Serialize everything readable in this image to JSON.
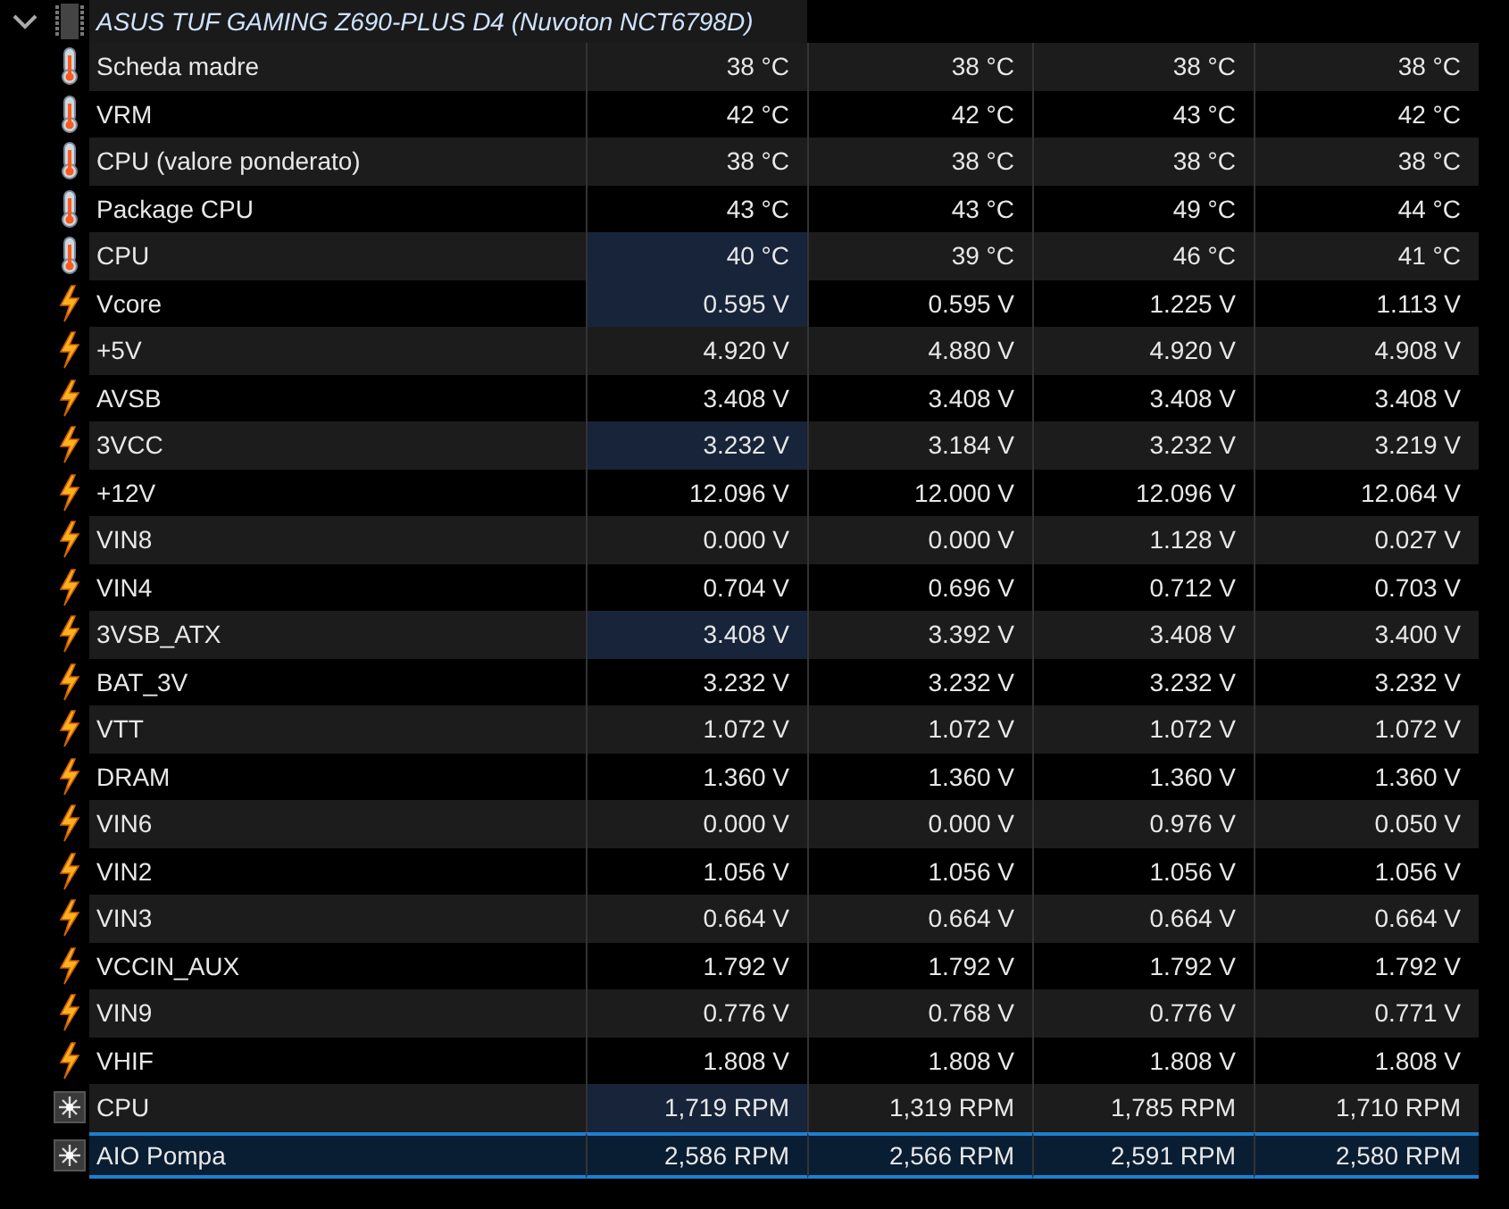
{
  "device": {
    "title": "ASUS TUF GAMING Z690-PLUS D4 (Nuvoton NCT6798D)",
    "expanded": true
  },
  "rows": [
    {
      "kind": "temperature",
      "label": "Scheda madre",
      "values": [
        "38 °C",
        "38 °C",
        "38 °C",
        "38 °C"
      ],
      "highlighted": false,
      "selected": false
    },
    {
      "kind": "temperature",
      "label": "VRM",
      "values": [
        "42 °C",
        "42 °C",
        "43 °C",
        "42 °C"
      ],
      "highlighted": false,
      "selected": false
    },
    {
      "kind": "temperature",
      "label": "CPU (valore ponderato)",
      "values": [
        "38 °C",
        "38 °C",
        "38 °C",
        "38 °C"
      ],
      "highlighted": false,
      "selected": false
    },
    {
      "kind": "temperature",
      "label": "Package CPU",
      "values": [
        "43 °C",
        "43 °C",
        "49 °C",
        "44 °C"
      ],
      "highlighted": false,
      "selected": false
    },
    {
      "kind": "temperature",
      "label": "CPU",
      "values": [
        "40 °C",
        "39 °C",
        "46 °C",
        "41 °C"
      ],
      "highlighted": true,
      "selected": false
    },
    {
      "kind": "voltage",
      "label": "Vcore",
      "values": [
        "0.595 V",
        "0.595 V",
        "1.225 V",
        "1.113 V"
      ],
      "highlighted": true,
      "selected": false
    },
    {
      "kind": "voltage",
      "label": "+5V",
      "values": [
        "4.920 V",
        "4.880 V",
        "4.920 V",
        "4.908 V"
      ],
      "highlighted": false,
      "selected": false
    },
    {
      "kind": "voltage",
      "label": "AVSB",
      "values": [
        "3.408 V",
        "3.408 V",
        "3.408 V",
        "3.408 V"
      ],
      "highlighted": false,
      "selected": false
    },
    {
      "kind": "voltage",
      "label": "3VCC",
      "values": [
        "3.232 V",
        "3.184 V",
        "3.232 V",
        "3.219 V"
      ],
      "highlighted": true,
      "selected": false
    },
    {
      "kind": "voltage",
      "label": "+12V",
      "values": [
        "12.096 V",
        "12.000 V",
        "12.096 V",
        "12.064 V"
      ],
      "highlighted": false,
      "selected": false
    },
    {
      "kind": "voltage",
      "label": "VIN8",
      "values": [
        "0.000 V",
        "0.000 V",
        "1.128 V",
        "0.027 V"
      ],
      "highlighted": false,
      "selected": false
    },
    {
      "kind": "voltage",
      "label": "VIN4",
      "values": [
        "0.704 V",
        "0.696 V",
        "0.712 V",
        "0.703 V"
      ],
      "highlighted": false,
      "selected": false
    },
    {
      "kind": "voltage",
      "label": "3VSB_ATX",
      "values": [
        "3.408 V",
        "3.392 V",
        "3.408 V",
        "3.400 V"
      ],
      "highlighted": true,
      "selected": false
    },
    {
      "kind": "voltage",
      "label": "BAT_3V",
      "values": [
        "3.232 V",
        "3.232 V",
        "3.232 V",
        "3.232 V"
      ],
      "highlighted": false,
      "selected": false
    },
    {
      "kind": "voltage",
      "label": "VTT",
      "values": [
        "1.072 V",
        "1.072 V",
        "1.072 V",
        "1.072 V"
      ],
      "highlighted": false,
      "selected": false
    },
    {
      "kind": "voltage",
      "label": "DRAM",
      "values": [
        "1.360 V",
        "1.360 V",
        "1.360 V",
        "1.360 V"
      ],
      "highlighted": false,
      "selected": false
    },
    {
      "kind": "voltage",
      "label": "VIN6",
      "values": [
        "0.000 V",
        "0.000 V",
        "0.976 V",
        "0.050 V"
      ],
      "highlighted": false,
      "selected": false
    },
    {
      "kind": "voltage",
      "label": "VIN2",
      "values": [
        "1.056 V",
        "1.056 V",
        "1.056 V",
        "1.056 V"
      ],
      "highlighted": false,
      "selected": false
    },
    {
      "kind": "voltage",
      "label": "VIN3",
      "values": [
        "0.664 V",
        "0.664 V",
        "0.664 V",
        "0.664 V"
      ],
      "highlighted": false,
      "selected": false
    },
    {
      "kind": "voltage",
      "label": "VCCIN_AUX",
      "values": [
        "1.792 V",
        "1.792 V",
        "1.792 V",
        "1.792 V"
      ],
      "highlighted": false,
      "selected": false
    },
    {
      "kind": "voltage",
      "label": "VIN9",
      "values": [
        "0.776 V",
        "0.768 V",
        "0.776 V",
        "0.771 V"
      ],
      "highlighted": false,
      "selected": false
    },
    {
      "kind": "voltage",
      "label": "VHIF",
      "values": [
        "1.808 V",
        "1.808 V",
        "1.808 V",
        "1.808 V"
      ],
      "highlighted": false,
      "selected": false
    },
    {
      "kind": "fan",
      "label": "CPU",
      "values": [
        "1,719 RPM",
        "1,319 RPM",
        "1,785 RPM",
        "1,710 RPM"
      ],
      "highlighted": true,
      "selected": false
    },
    {
      "kind": "fan",
      "label": "AIO Pompa",
      "values": [
        "2,586 RPM",
        "2,566 RPM",
        "2,591 RPM",
        "2,580 RPM"
      ],
      "highlighted": false,
      "selected": true
    }
  ]
}
